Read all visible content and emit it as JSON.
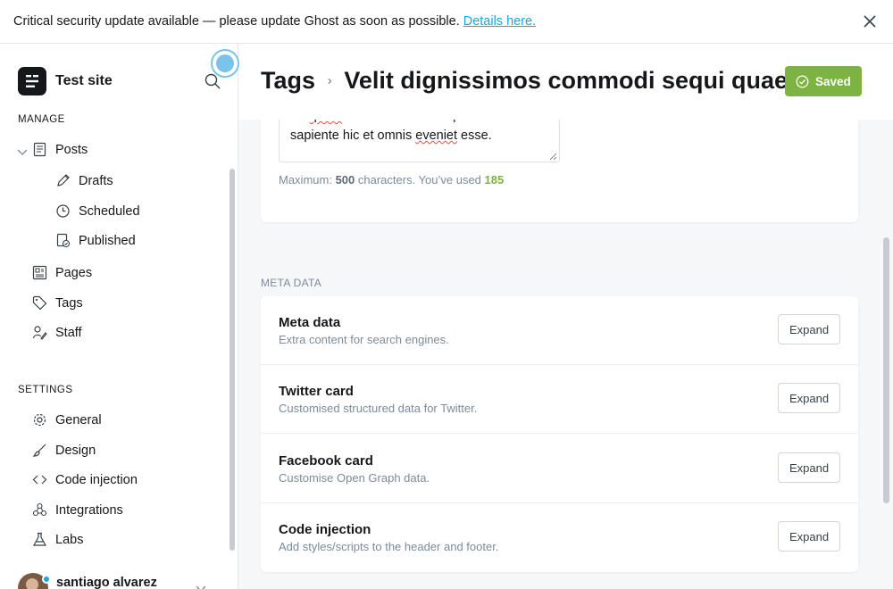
{
  "banner": {
    "message": "Critical security update available — please update Ghost as soon as possible.",
    "link_text": "Details here."
  },
  "sidebar": {
    "site_name": "Test site",
    "manage_title": "MANAGE",
    "settings_title": "SETTINGS",
    "manage_items": [
      {
        "label": "Posts",
        "icon": "posts-icon"
      },
      {
        "label": "Drafts",
        "icon": "pencil-icon"
      },
      {
        "label": "Scheduled",
        "icon": "clock-icon"
      },
      {
        "label": "Published",
        "icon": "published-icon"
      },
      {
        "label": "Pages",
        "icon": "pages-icon"
      },
      {
        "label": "Tags",
        "icon": "tag-icon"
      },
      {
        "label": "Staff",
        "icon": "staff-icon"
      }
    ],
    "settings_items": [
      {
        "label": "General",
        "icon": "gear-icon"
      },
      {
        "label": "Design",
        "icon": "brush-icon"
      },
      {
        "label": "Code injection",
        "icon": "code-icon"
      },
      {
        "label": "Integrations",
        "icon": "integrations-icon"
      },
      {
        "label": "Labs",
        "icon": "flask-icon"
      }
    ],
    "user_name": "santiago alvarez"
  },
  "header": {
    "breadcrumb_parent": "Tags",
    "breadcrumb_current": "Velit dignissimos commodi sequi quae",
    "saved_label": "Saved"
  },
  "description": {
    "line1_pre": "illo ",
    "line1_squig": "quam",
    "line1_post": " animi nemo unde quas. Odio",
    "line2_pre": "sapiente hic et omnis ",
    "line2_squig": "eveniet",
    "line2_post": " esse.",
    "counter_prefix": "Maximum: ",
    "counter_max": "500",
    "counter_mid": " characters. You’ve used ",
    "counter_used": "185"
  },
  "meta": {
    "section_label": "META DATA",
    "rows": [
      {
        "title": "Meta data",
        "description": "Extra content for search engines.",
        "button": "Expand"
      },
      {
        "title": "Twitter card",
        "description": "Customised structured data for Twitter.",
        "button": "Expand"
      },
      {
        "title": "Facebook card",
        "description": "Customise Open Graph data.",
        "button": "Expand"
      },
      {
        "title": "Code injection",
        "description": "Add styles/scripts to the header and footer.",
        "button": "Expand"
      }
    ]
  },
  "colors": {
    "accent_green": "#7cb342",
    "link_blue": "#14a8e6"
  }
}
